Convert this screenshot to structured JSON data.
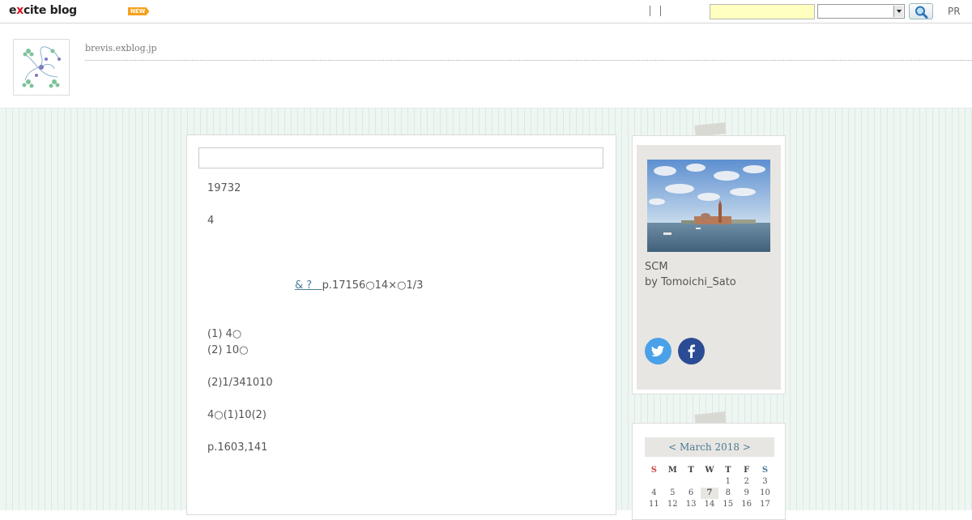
{
  "topbar": {
    "logo_prefix": "e",
    "logo_x": "x",
    "logo_suffix": "cite blog",
    "new_badge": "NEW",
    "search_placeholder": "",
    "select_value": "",
    "pr_label": "PR"
  },
  "header": {
    "site_url": "brevis.exblog.jp"
  },
  "article": {
    "title": "",
    "lines": [
      "19732",
      "4",
      "p.17156○14×○1/3",
      "(1) 4○",
      "(2) 10○",
      "(2)1/341010",
      "4○(1)10(2)",
      "p.1603,141"
    ],
    "link_text": "& ?"
  },
  "sidebar": {
    "blog_name": "SCM",
    "author": "by Tomoichi_Sato",
    "social": [
      "twitter-icon",
      "facebook-icon"
    ]
  },
  "calendar": {
    "prev": "<",
    "month": "March 2018",
    "next": ">",
    "weekdays": [
      "S",
      "M",
      "T",
      "W",
      "T",
      "F",
      "S"
    ],
    "weeks": [
      [
        "",
        "",
        "",
        "",
        "1",
        "2",
        "3"
      ],
      [
        "4",
        "5",
        "6",
        "7",
        "8",
        "9",
        "10"
      ],
      [
        "11",
        "12",
        "13",
        "14",
        "15",
        "16",
        "17"
      ]
    ],
    "today": "7"
  },
  "colors": {
    "accent_link": "#4a7b96",
    "background": "#eef6f2",
    "search_bg": "#ffffc0",
    "twitter": "#4aa1e8",
    "facebook": "#2b4c94"
  }
}
